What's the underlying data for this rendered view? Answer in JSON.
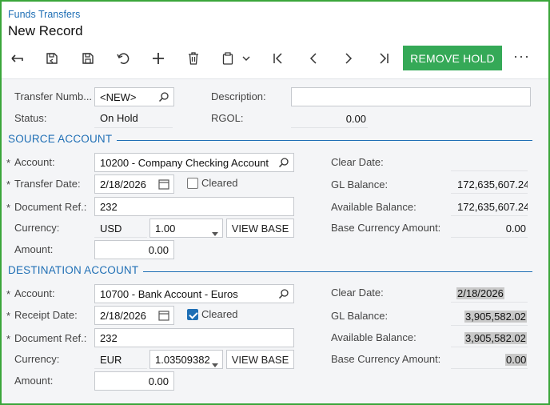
{
  "header": {
    "breadcrumb": "Funds Transfers",
    "title": "New Record",
    "remove_hold": "REMOVE HOLD",
    "more": "···"
  },
  "summary": {
    "transfer_number_label": "Transfer Numb...",
    "transfer_number_value": "<NEW>",
    "description_label": "Description:",
    "description_value": "",
    "status_label": "Status:",
    "status_value": "On Hold",
    "rgol_label": "RGOL:",
    "rgol_value": "0.00"
  },
  "source": {
    "section_title": "SOURCE ACCOUNT",
    "account_label": "Account:",
    "account_value": "10200 - Company Checking Account",
    "date_label": "Transfer Date:",
    "date_value": "2/18/2026",
    "cleared_label": "Cleared",
    "cleared_checked": false,
    "docref_label": "Document Ref.:",
    "docref_value": "232",
    "currency_label": "Currency:",
    "currency_value": "USD",
    "rate_value": "1.00",
    "view_base": "VIEW BASE",
    "amount_label": "Amount:",
    "amount_value": "0.00",
    "clear_date_label": "Clear Date:",
    "clear_date_value": "",
    "gl_balance_label": "GL Balance:",
    "gl_balance_value": "172,635,607.24",
    "available_balance_label": "Available Balance:",
    "available_balance_value": "172,635,607.24",
    "base_currency_label": "Base Currency Amount:",
    "base_currency_value": "0.00"
  },
  "destination": {
    "section_title": "DESTINATION ACCOUNT",
    "account_label": "Account:",
    "account_value": "10700 - Bank Account - Euros",
    "date_label": "Receipt Date:",
    "date_value": "2/18/2026",
    "cleared_label": "Cleared",
    "cleared_checked": true,
    "docref_label": "Document Ref.:",
    "docref_value": "232",
    "currency_label": "Currency:",
    "currency_value": "EUR",
    "rate_value": "1.03509382",
    "view_base": "VIEW BASE",
    "amount_label": "Amount:",
    "amount_value": "0.00",
    "clear_date_label": "Clear Date:",
    "clear_date_value": "2/18/2026",
    "gl_balance_label": "GL Balance:",
    "gl_balance_value": "3,905,582.02",
    "available_balance_label": "Available Balance:",
    "available_balance_value": "3,905,582.02",
    "base_currency_label": "Base Currency Amount:",
    "base_currency_value": "0.00"
  },
  "colors": {
    "accent": "#1f6fb5",
    "primary_button": "#35a957",
    "frame_border": "#3aa63a"
  }
}
